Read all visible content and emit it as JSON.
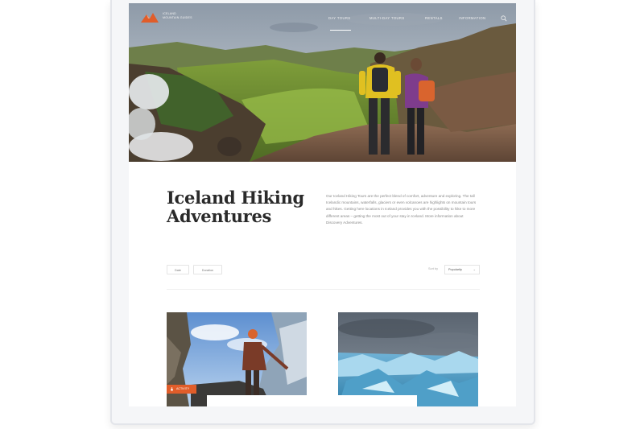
{
  "site": {
    "logo_text": "ICELAND\nMOUNTAIN GUIDES",
    "brand_color": "#e05d2a"
  },
  "nav": {
    "items": [
      {
        "label": "DAY TOURS"
      },
      {
        "label": "MULTI-DAY TOURS"
      },
      {
        "label": "RENTALS"
      },
      {
        "label": "INFORMATION"
      }
    ],
    "search_icon": "search-icon"
  },
  "intro": {
    "title": "Iceland Hiking Adventures",
    "description": "Our Iceland Hiking Tours are the perfect blend of comfort, adventure and exploring. The tall Icelandic mountains, waterfalls, glaciers or even volcanoes are highlights on mountain tours and hikes. Getting here locations in Iceland provides you with the possibility to hike to more different areas – getting the most out of your stay in Iceland. More information about Discovery Adventures."
  },
  "filters": {
    "buttons": [
      {
        "label": "Date"
      },
      {
        "label": "Duration"
      }
    ],
    "sort_label": "Sort by",
    "sort_value": "Popularity"
  },
  "cards": [
    {
      "badge_label": "ACTIVITY",
      "badge_icon": "hiker-icon"
    },
    {}
  ]
}
